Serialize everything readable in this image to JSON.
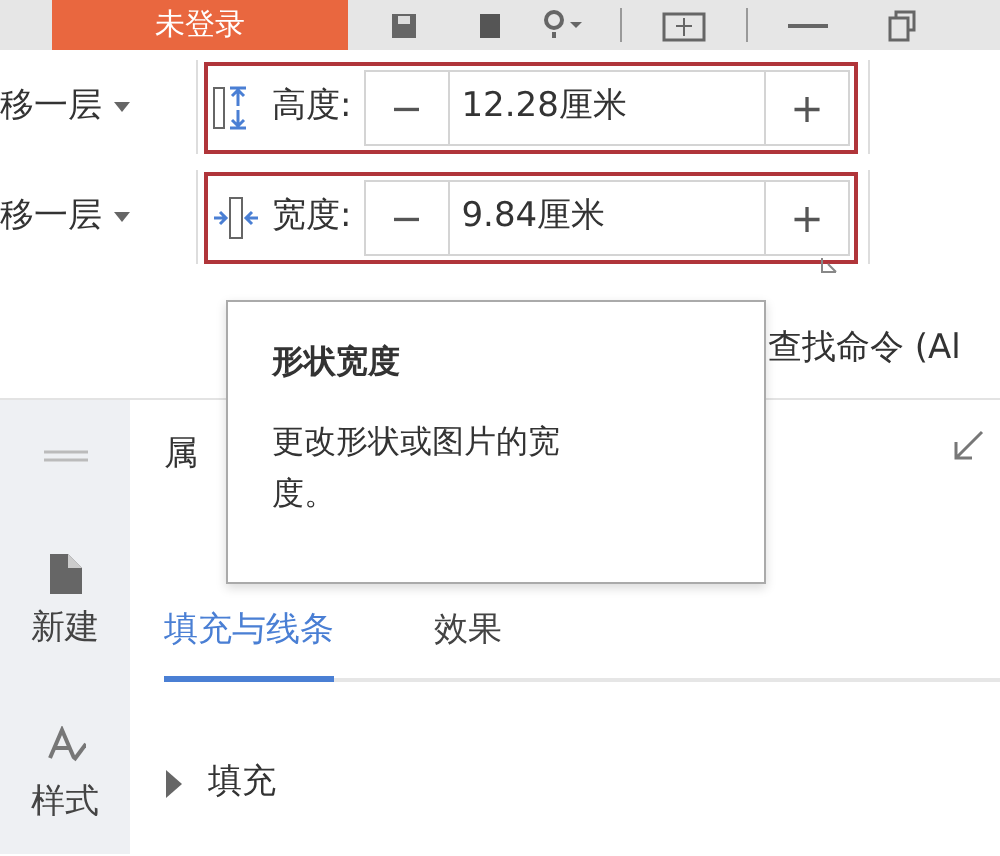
{
  "title_bar": {
    "login_button": "未登录"
  },
  "ribbon": {
    "rows": [
      {
        "layer_button": "移一层",
        "kind": "height",
        "label": "高度:",
        "minus": "−",
        "value": "12.28厘米",
        "plus": "+"
      },
      {
        "layer_button": "移一层",
        "kind": "width",
        "label": "宽度:",
        "minus": "−",
        "value": "9.84厘米",
        "plus": "+"
      }
    ]
  },
  "search": {
    "placeholder": "查找命令 (Al"
  },
  "sidebar": {
    "items": [
      {
        "kind": "new",
        "label": "新建"
      },
      {
        "kind": "style",
        "label": "样式"
      }
    ]
  },
  "panel": {
    "title": "属",
    "tabs": [
      {
        "label": "填充与线条",
        "selected": true
      },
      {
        "label": "效果",
        "selected": false
      }
    ],
    "sections": [
      {
        "label": "填充",
        "expanded": false
      }
    ]
  },
  "tooltip": {
    "title": "形状宽度",
    "body": "更改形状或图片的宽度。"
  }
}
